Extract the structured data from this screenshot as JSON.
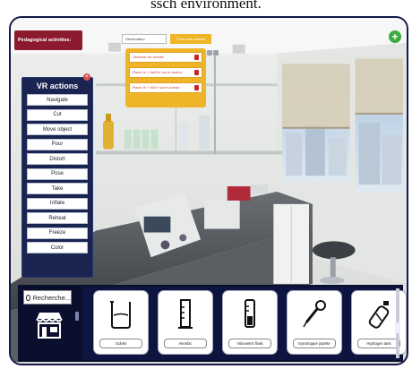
{
  "caption": "ssch environment.",
  "topbar": {
    "pedagogical_label": "Pedagogical activities:",
    "observation_value": "Observation",
    "choose_label": "Choix des réactifs",
    "add_symbol": "+"
  },
  "activities": [
    {
      "label": "Observer les réactifs"
    },
    {
      "label": "Placer le + NaOH+ sur le chariot"
    },
    {
      "label": "Placer le + H2O+ sur le chariot"
    }
  ],
  "vr_actions": {
    "title": "VR actions",
    "close_symbol": "×",
    "items": [
      {
        "label": "Navigate"
      },
      {
        "label": "Cut"
      },
      {
        "label": "Move object"
      },
      {
        "label": "Pour"
      },
      {
        "label": "Distort"
      },
      {
        "label": "Pose"
      },
      {
        "label": "Take"
      },
      {
        "label": "Inflate"
      },
      {
        "label": "Reheat"
      },
      {
        "label": "Freeze"
      },
      {
        "label": "Color"
      }
    ]
  },
  "search": {
    "placeholder": "Recherche..."
  },
  "catalog": {
    "items": [
      {
        "label": "Goblet",
        "icon": "beaker-icon"
      },
      {
        "label": "Alembic",
        "icon": "graduated-cylinder-icon"
      },
      {
        "label": "Volumetric flask",
        "icon": "volumetric-flask-icon"
      },
      {
        "label": "Eyedropper pipette",
        "icon": "pipette-icon"
      },
      {
        "label": "Hydrogen tank",
        "icon": "gas-tank-icon"
      }
    ]
  },
  "colors": {
    "frame": "#0b0f2e",
    "pedagogical": "#8b1a2e",
    "accent": "#f0b428",
    "vr_panel": "#1a2450",
    "add": "#3dab3d"
  }
}
